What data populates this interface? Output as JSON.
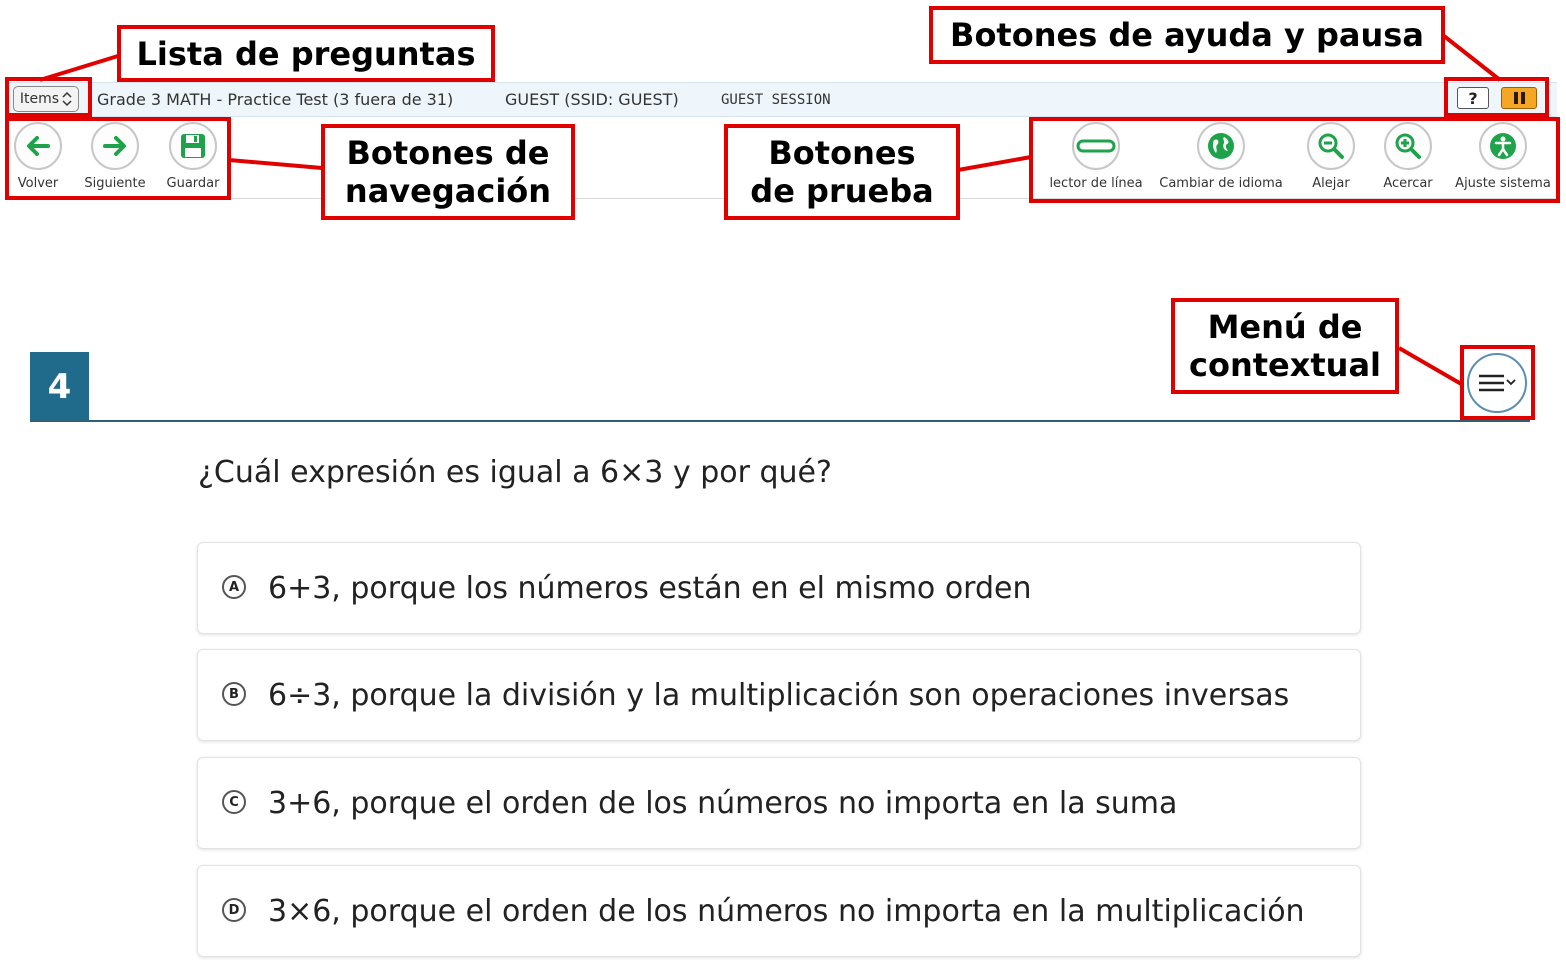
{
  "header": {
    "items_label": "Items",
    "test_title": "Grade 3 MATH - Practice Test (3 fuera de 31)",
    "user": "GUEST (SSID: GUEST)",
    "session": "GUEST SESSION",
    "help_label": "?"
  },
  "nav_buttons": {
    "back": "Volver",
    "next": "Siguiente",
    "save": "Guardar"
  },
  "test_tools": {
    "line_reader": "lector de línea",
    "language": "Cambiar de idioma",
    "zoom_out": "Alejar",
    "zoom_in": "Acercar",
    "settings": "Ajuste sistema"
  },
  "annotations": {
    "question_list": "Lista de preguntas",
    "help_pause": "Botones de ayuda y pausa",
    "navigation": "Botones de navegación",
    "test_buttons": "Botones de prueba",
    "context_menu": "Menú de contextual"
  },
  "question": {
    "number": "4",
    "prompt": "¿Cuál expresión es igual a 6×3 y por qué?",
    "options": [
      {
        "letter": "A",
        "text": "6+3, porque los números están en el mismo orden"
      },
      {
        "letter": "B",
        "text": "6÷3, porque la división y la multiplicación son operaciones inversas"
      },
      {
        "letter": "C",
        "text": "3+6, porque el orden de los números no importa en la suma"
      },
      {
        "letter": "D",
        "text": "3×6, porque el orden de los números no importa en la multiplicación"
      }
    ]
  },
  "colors": {
    "accent_green": "#1fa34a",
    "question_blue": "#206b8c",
    "annotation_red": "#e00000",
    "pause_orange": "#f5a623"
  }
}
